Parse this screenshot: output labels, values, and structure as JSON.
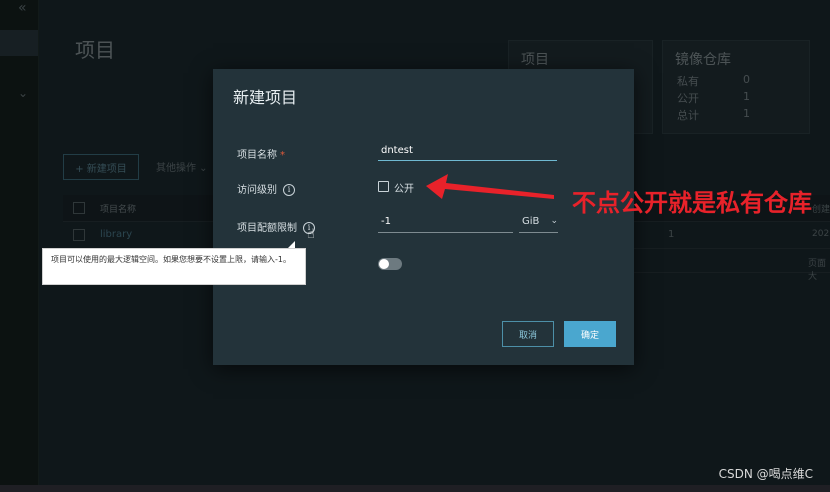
{
  "background": {
    "collapse_icon": "«",
    "chevron": "⌄",
    "page_title": "项目",
    "cards": [
      {
        "title": "项目",
        "rows": []
      },
      {
        "title": "镜像仓库",
        "rows": [
          {
            "label": "私有",
            "value": "0"
          },
          {
            "label": "公开",
            "value": "1"
          },
          {
            "label": "总计",
            "value": "1"
          }
        ]
      }
    ],
    "new_project_button": "+ 新建项目",
    "more_actions": "其他操作 ⌄",
    "table": {
      "header_name": "项目名称",
      "header_right": "创建",
      "row_name": "library",
      "row_count": "1",
      "row_right": "202",
      "pager_right": "页面大"
    }
  },
  "modal": {
    "title": "新建项目",
    "fields": {
      "name_label": "项目名称",
      "required_mark": "*",
      "name_value": "dntest",
      "access_label": "访问级别",
      "public_label": "公开",
      "public_checked": false,
      "quota_label": "项目配额限制",
      "quota_value": "-1",
      "quota_unit": "GiB",
      "proxy_cache_enabled": false
    },
    "buttons": {
      "cancel": "取消",
      "ok": "确定"
    }
  },
  "tooltip": {
    "text": "项目可以使用的最大逻辑空间。如果您想要不设置上限，请输入-1。"
  },
  "annotation": {
    "text": "不点公开就是私有仓库",
    "color": "#e8222a"
  },
  "watermark": "CSDN @喝点维C",
  "colors": {
    "accent": "#4aa7cf",
    "modal_bg": "#23333a",
    "annotation_red": "#e8222a"
  }
}
